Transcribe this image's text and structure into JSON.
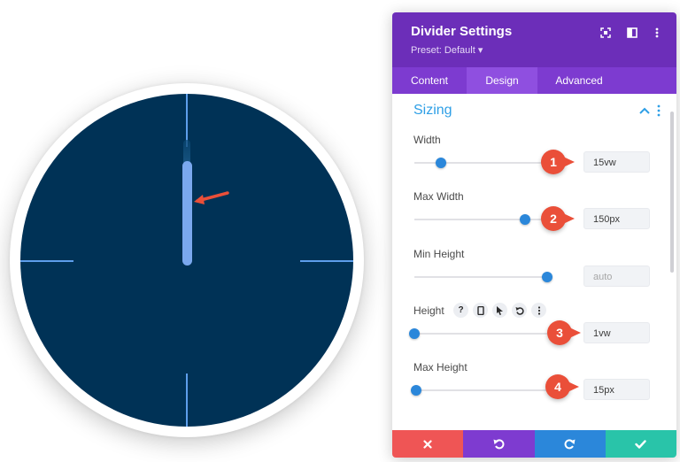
{
  "panel": {
    "title": "Divider Settings",
    "preset": "Preset: Default ▾"
  },
  "tabs": [
    {
      "label": "Content",
      "active": false
    },
    {
      "label": "Design",
      "active": true
    },
    {
      "label": "Advanced",
      "active": false
    }
  ],
  "section": {
    "title": "Sizing"
  },
  "fields": {
    "width": {
      "label": "Width",
      "value": "15vw",
      "slider": 0.2
    },
    "max_width": {
      "label": "Max Width",
      "value": "150px",
      "slider": 0.83
    },
    "min_height": {
      "label": "Min Height",
      "placeholder": "auto",
      "slider": 1.0
    },
    "height": {
      "label": "Height",
      "value": "1vw",
      "slider": 0.0
    },
    "max_height": {
      "label": "Max Height",
      "value": "15px",
      "slider": 0.01
    }
  },
  "height_tools": {
    "help": "?"
  },
  "badges": [
    "1",
    "2",
    "3",
    "4"
  ],
  "colors": {
    "header": "#6c2eb9",
    "tabs": "#7d3bd0",
    "accent": "#2e9fe6",
    "clock_face": "#003256",
    "clock_hand": "#7aa8ee",
    "badge": "#ea4f39",
    "discard": "#ef5555",
    "undo": "#7e3bd0",
    "redo": "#2b87da",
    "save": "#29c4a9"
  },
  "icons": {
    "header": [
      "focus-icon",
      "split-view-icon",
      "more-vertical-icon"
    ],
    "height_tools": [
      "help-icon",
      "device-icon",
      "cursor-icon",
      "reset-icon",
      "more-vertical-icon"
    ],
    "footer": [
      "close-icon",
      "undo-icon",
      "redo-icon",
      "check-icon"
    ]
  }
}
